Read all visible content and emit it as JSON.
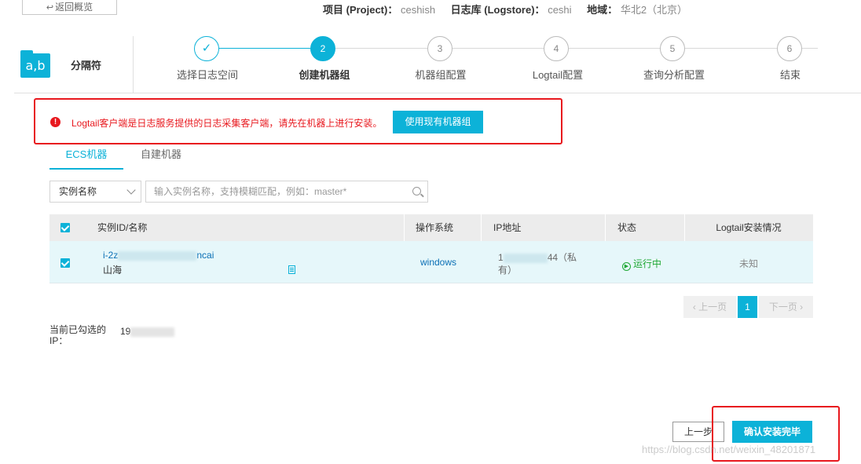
{
  "header": {
    "back_label": "返回概览",
    "project_key": "项目 (Project)：",
    "project_value": "ceshish",
    "logstore_key": "日志库 (Logstore)：",
    "logstore_value": "ceshi",
    "region_key": "地域：",
    "region_value": "华北2（北京）"
  },
  "source": {
    "logo_text": "a,b",
    "name": "分隔符"
  },
  "steps": [
    {
      "num": "✓",
      "label": "选择日志空间",
      "state": "done"
    },
    {
      "num": "2",
      "label": "创建机器组",
      "state": "active"
    },
    {
      "num": "3",
      "label": "机器组配置",
      "state": "todo"
    },
    {
      "num": "4",
      "label": "Logtail配置",
      "state": "todo"
    },
    {
      "num": "5",
      "label": "查询分析配置",
      "state": "todo"
    },
    {
      "num": "6",
      "label": "结束",
      "state": "todo"
    }
  ],
  "alert": {
    "icon": "!",
    "text": "Logtail客户端是日志服务提供的日志采集客户端，请先在机器上进行安装。",
    "button_label": "使用现有机器组"
  },
  "tabs": [
    {
      "label": "ECS机器",
      "active": true
    },
    {
      "label": "自建机器",
      "active": false
    }
  ],
  "filter": {
    "select_value": "实例名称",
    "search_placeholder": "输入实例名称，支持模糊匹配，例如：master*"
  },
  "table": {
    "headers": {
      "id_name": "实例ID/名称",
      "os": "操作系统",
      "ip": "IP地址",
      "status": "状态",
      "logtail": "Logtail安装情况"
    },
    "rows": [
      {
        "id_prefix": "i-2z",
        "id_suffix": "ncai",
        "name": "山海",
        "os": "windows",
        "ip_prefix": "1",
        "ip_suffix": "44（私",
        "ip_line2": "有）",
        "status": "运行中",
        "logtail": "未知"
      }
    ]
  },
  "pager": {
    "prev": "上一页",
    "current": "1",
    "next": "下一页"
  },
  "selection": {
    "label": "当前已勾选的IP：",
    "ip_prefix": "19"
  },
  "footer": {
    "prev_step": "上一步",
    "confirm": "确认安装完毕"
  },
  "watermark": "https://blog.csdn.net/weixin_48201871",
  "colors": {
    "accent": "#0cb2d8",
    "error": "#e8181e",
    "running": "#1fa834"
  }
}
